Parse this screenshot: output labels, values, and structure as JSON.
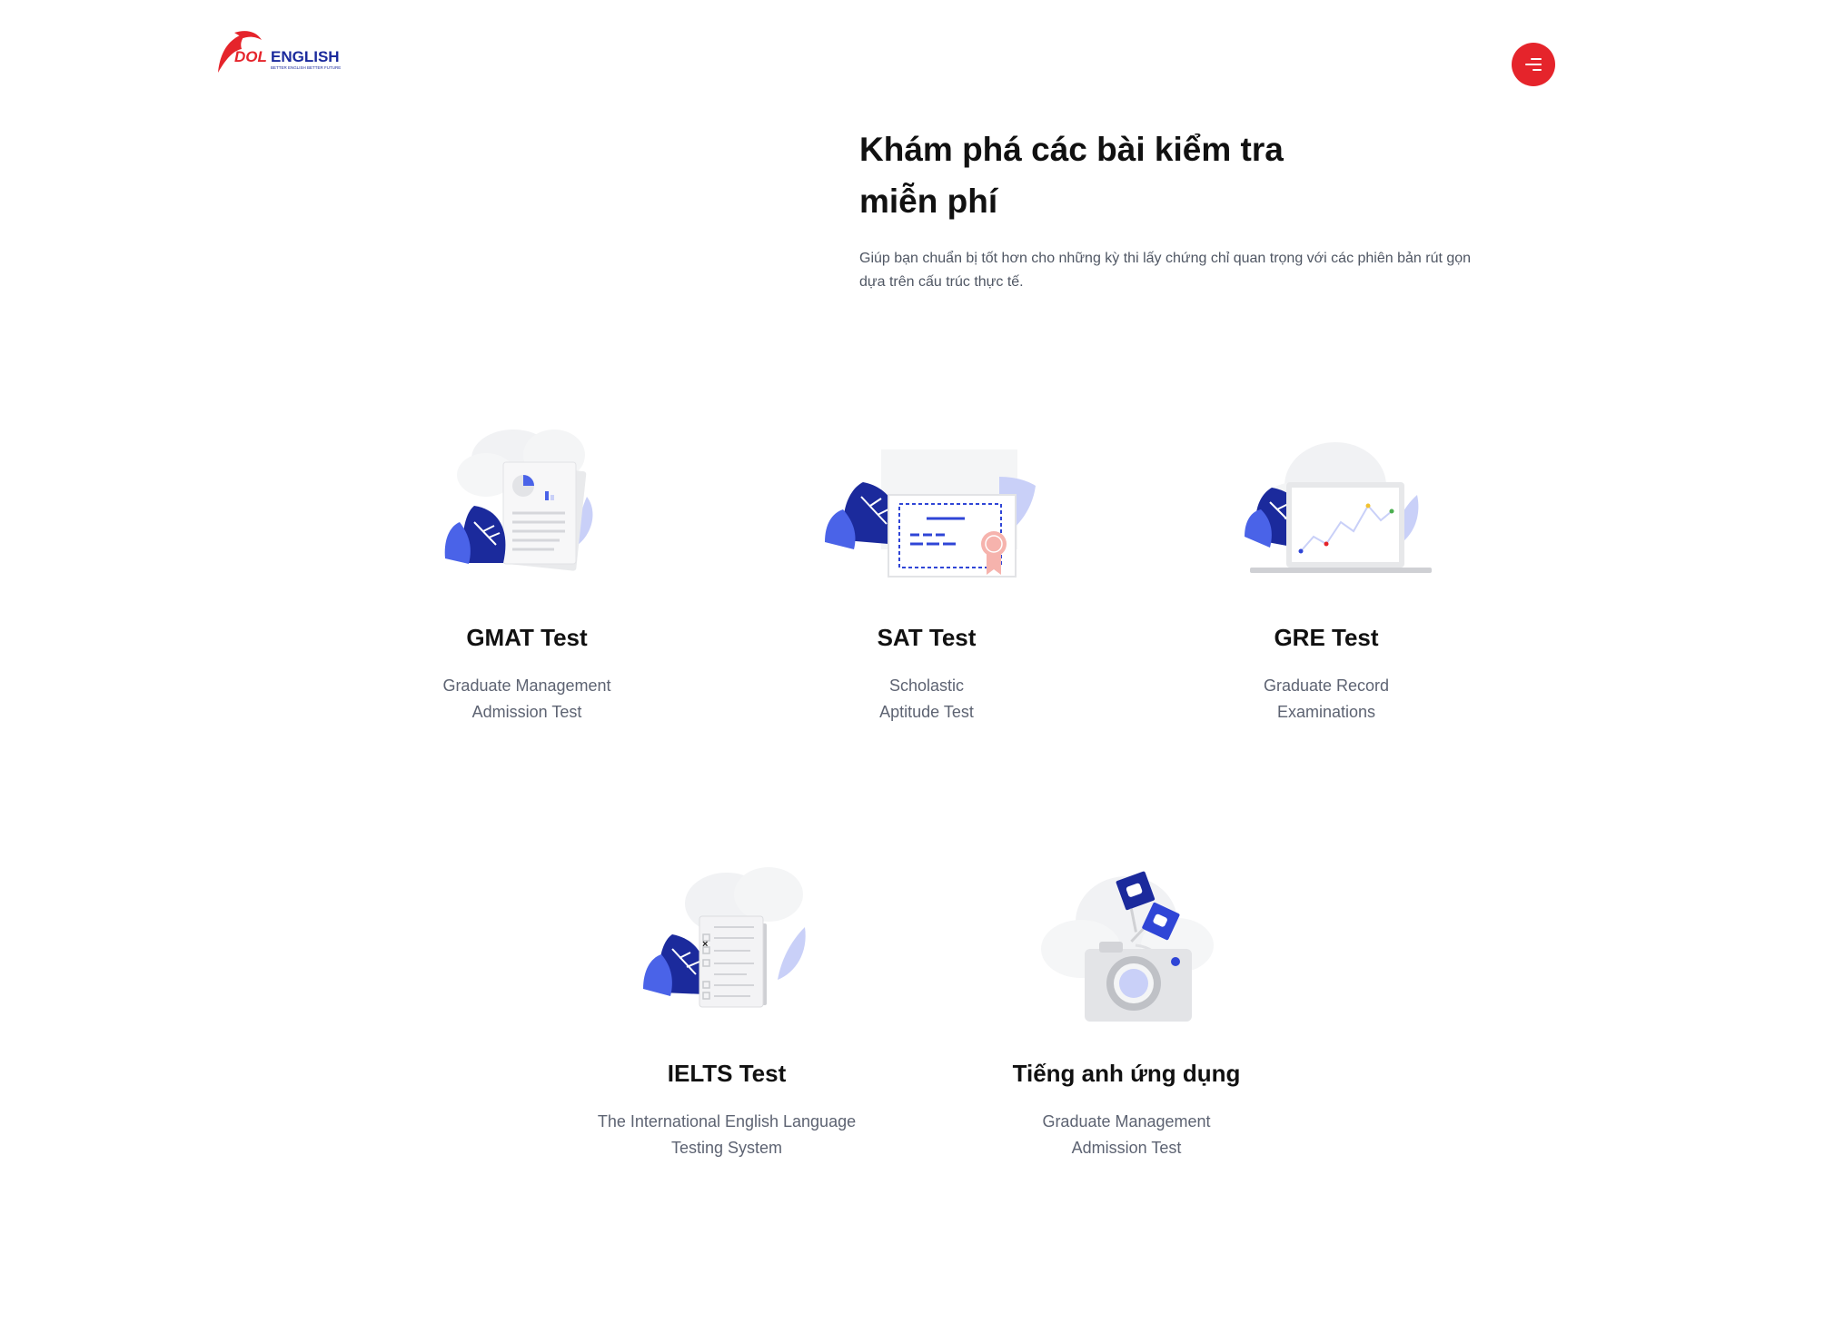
{
  "header": {
    "logo_text": "DOL ENGLISH",
    "logo_tagline": "BETTER ENGLISH BETTER FUTURE",
    "menu_icon": "hamburger-menu-icon"
  },
  "hero": {
    "title": "Khám phá các bài kiểm tra miễn phí",
    "subtitle": "Giúp bạn chuẩn bị tốt hơn cho những kỳ thi lấy chứng chỉ quan trọng với các phiên bản rút gọn dựa trên cấu trúc thực tế."
  },
  "tests": [
    {
      "title": "GMAT Test",
      "desc_line1": "Graduate Management",
      "desc_line2": "Admission Test",
      "icon": "document-chart-icon"
    },
    {
      "title": "SAT Test",
      "desc_line1": "Scholastic",
      "desc_line2": "Aptitude Test",
      "icon": "certificate-icon"
    },
    {
      "title": "GRE Test",
      "desc_line1": "Graduate Record",
      "desc_line2": "Examinations",
      "icon": "laptop-chart-icon"
    },
    {
      "title": "IELTS Test",
      "desc_line1": "The International English Language",
      "desc_line2": "Testing System",
      "icon": "checklist-document-icon"
    },
    {
      "title": "Tiếng anh ứng dụng",
      "desc_line1": "Graduate Management",
      "desc_line2": "Admission Test",
      "icon": "camera-icon"
    }
  ],
  "colors": {
    "brand_red": "#e5242b",
    "brand_navy": "#1b2a9c",
    "accent_blue": "#4a63e8",
    "light_blue": "#c9d0f8",
    "text_dark": "#111111",
    "text_muted": "#5d6372"
  }
}
